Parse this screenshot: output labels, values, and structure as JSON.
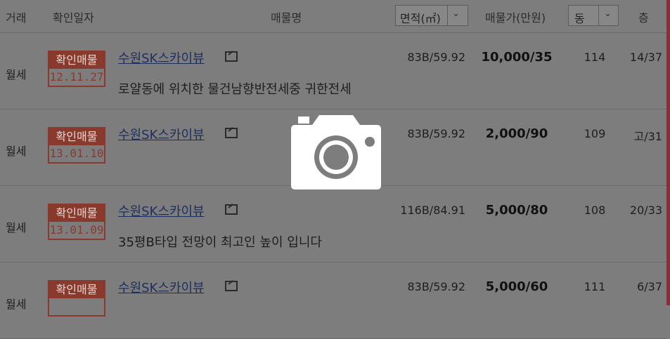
{
  "header": {
    "deal_type": "거래",
    "confirm_date": "확인일자",
    "listing_name": "매물명",
    "area": "면적(㎡)",
    "price": "매물가(만원)",
    "dong": "동",
    "floor": "층"
  },
  "rows": [
    {
      "deal_type": "월세",
      "stamp_label": "확인매물",
      "stamp_date": "12.11.27",
      "name": "수원SK스카이뷰",
      "description": "로얄동에 위치한 물건남향반전세중 귀한전세",
      "area": "83B/59.92",
      "price": "10,000/35",
      "dong": "114",
      "floor": "14/37"
    },
    {
      "deal_type": "월세",
      "stamp_label": "확인매물",
      "stamp_date": "13.01.10",
      "name": "수원SK스카이뷰",
      "description": "",
      "area": "83B/59.92",
      "price": "2,000/90",
      "dong": "109",
      "floor": "고/31"
    },
    {
      "deal_type": "월세",
      "stamp_label": "확인매물",
      "stamp_date": "13.01.09",
      "name": "수원SK스카이뷰",
      "description": "35평B타입 전망이 최고인 높이 입니다",
      "area": "116B/84.91",
      "price": "5,000/80",
      "dong": "108",
      "floor": "20/33"
    },
    {
      "deal_type": "월세",
      "stamp_label": "확인매물",
      "stamp_date": "",
      "name": "수원SK스카이뷰",
      "description": "",
      "area": "83B/59.92",
      "price": "5,000/60",
      "dong": "111",
      "floor": "6/37"
    }
  ],
  "icons": {
    "sort_dropdown": "chevron-down-icon",
    "external_link": "external-link-icon",
    "overlay": "camera-icon"
  }
}
